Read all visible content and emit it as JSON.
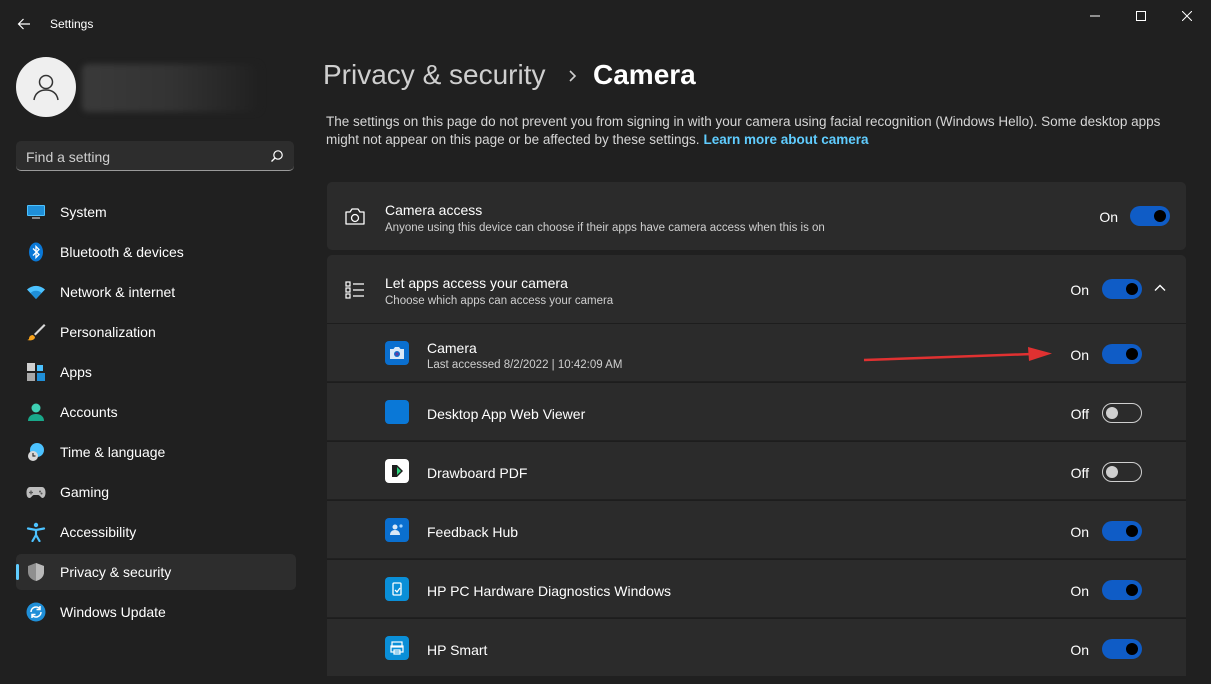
{
  "window": {
    "title": "Settings",
    "back_label": "←"
  },
  "search": {
    "placeholder": "Find a setting"
  },
  "sidebar": {
    "items": [
      {
        "label": "System",
        "icon": "monitor-icon",
        "active": false
      },
      {
        "label": "Bluetooth & devices",
        "icon": "bluetooth-icon",
        "active": false
      },
      {
        "label": "Network & internet",
        "icon": "wifi-icon",
        "active": false
      },
      {
        "label": "Personalization",
        "icon": "brush-icon",
        "active": false
      },
      {
        "label": "Apps",
        "icon": "apps-icon",
        "active": false
      },
      {
        "label": "Accounts",
        "icon": "person-icon",
        "active": false
      },
      {
        "label": "Time & language",
        "icon": "globe-clock-icon",
        "active": false
      },
      {
        "label": "Gaming",
        "icon": "gamepad-icon",
        "active": false
      },
      {
        "label": "Accessibility",
        "icon": "accessibility-icon",
        "active": false
      },
      {
        "label": "Privacy & security",
        "icon": "shield-icon",
        "active": true
      },
      {
        "label": "Windows Update",
        "icon": "update-icon",
        "active": false
      }
    ]
  },
  "breadcrumb": {
    "parent": "Privacy & security",
    "current": "Camera"
  },
  "description": {
    "text": "The settings on this page do not prevent you from signing in with your camera using facial recognition (Windows Hello). Some desktop apps might not appear on this page or be affected by these settings.",
    "link": "Learn more about camera"
  },
  "camera_access": {
    "title": "Camera access",
    "subtitle": "Anyone using this device can choose if their apps have camera access when this is on",
    "state_label": "On",
    "on": true
  },
  "let_apps": {
    "title": "Let apps access your camera",
    "subtitle": "Choose which apps can access your camera",
    "state_label": "On",
    "on": true
  },
  "apps": [
    {
      "name": "Camera",
      "subtitle": "Last accessed 8/2/2022  |  10:42:09 AM",
      "state_label": "On",
      "on": true,
      "icon": "camera-app-icon",
      "color": "#0a6fcf"
    },
    {
      "name": "Desktop App Web Viewer",
      "subtitle": "",
      "state_label": "Off",
      "on": false,
      "icon": "web-viewer-icon",
      "color": "#0a78d7"
    },
    {
      "name": "Drawboard PDF",
      "subtitle": "",
      "state_label": "Off",
      "on": false,
      "icon": "drawboard-icon",
      "color": "#ffffff"
    },
    {
      "name": "Feedback Hub",
      "subtitle": "",
      "state_label": "On",
      "on": true,
      "icon": "feedback-hub-icon",
      "color": "#0a6fcf"
    },
    {
      "name": "HP PC Hardware Diagnostics Windows",
      "subtitle": "",
      "state_label": "On",
      "on": true,
      "icon": "hp-diagnostics-icon",
      "color": "#0a8fd8"
    },
    {
      "name": "HP Smart",
      "subtitle": "",
      "state_label": "On",
      "on": true,
      "icon": "hp-smart-icon",
      "color": "#0a8fd8"
    }
  ],
  "colors": {
    "accent": "#0f5cc6",
    "link": "#60cdff",
    "background": "#202020",
    "card": "#2b2b2b",
    "annotation_arrow": "#e03131"
  }
}
